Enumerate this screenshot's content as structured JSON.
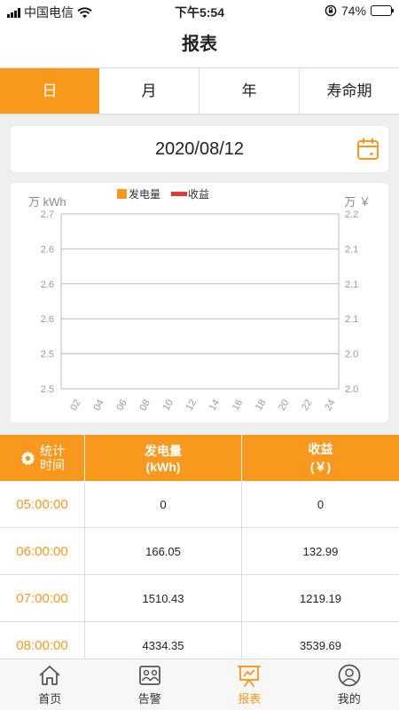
{
  "status": {
    "carrier": "中国电信",
    "time": "下午5:54",
    "battery": "74%",
    "battery_level": 0.74
  },
  "header": {
    "title": "报表"
  },
  "tabs": [
    {
      "label": "日",
      "active": true
    },
    {
      "label": "月",
      "active": false
    },
    {
      "label": "年",
      "active": false
    },
    {
      "label": "寿命期",
      "active": false
    }
  ],
  "date": {
    "value": "2020/08/12"
  },
  "chart_data": {
    "type": "bar",
    "left_unit": "万 kWh",
    "right_unit": "万 ￥",
    "legend": [
      {
        "name": "发电量",
        "color": "#f8981d"
      },
      {
        "name": "收益",
        "color": "#e53935"
      }
    ],
    "left_ticks": [
      "2.5",
      "2.5",
      "2.6",
      "2.6",
      "2.6",
      "2.7"
    ],
    "right_ticks": [
      "2.0",
      "2.0",
      "2.1",
      "2.1",
      "2.1",
      "2.2"
    ],
    "categories": [
      "02",
      "04",
      "06",
      "08",
      "10",
      "12",
      "14",
      "16",
      "18",
      "20",
      "22",
      "24"
    ],
    "grid": true,
    "series": [
      {
        "name": "发电量",
        "values": []
      },
      {
        "name": "收益",
        "values": []
      }
    ]
  },
  "table": {
    "header": {
      "time_line1": "统计",
      "time_line2": "时间",
      "energy_line1": "发电量",
      "energy_line2": "(kWh)",
      "income_line1": "收益",
      "income_line2": "(￥)"
    },
    "rows": [
      {
        "time": "05:00:00",
        "energy": "0",
        "income": "0"
      },
      {
        "time": "06:00:00",
        "energy": "166.05",
        "income": "132.99"
      },
      {
        "time": "07:00:00",
        "energy": "1510.43",
        "income": "1219.19"
      },
      {
        "time": "08:00:00",
        "energy": "4334.35",
        "income": "3539.69"
      }
    ]
  },
  "bottom_nav": [
    {
      "label": "首页",
      "icon": "home-icon",
      "active": false
    },
    {
      "label": "告警",
      "icon": "alarm-icon",
      "active": false
    },
    {
      "label": "报表",
      "icon": "report-icon",
      "active": true
    },
    {
      "label": "我的",
      "icon": "user-icon",
      "active": false
    }
  ]
}
